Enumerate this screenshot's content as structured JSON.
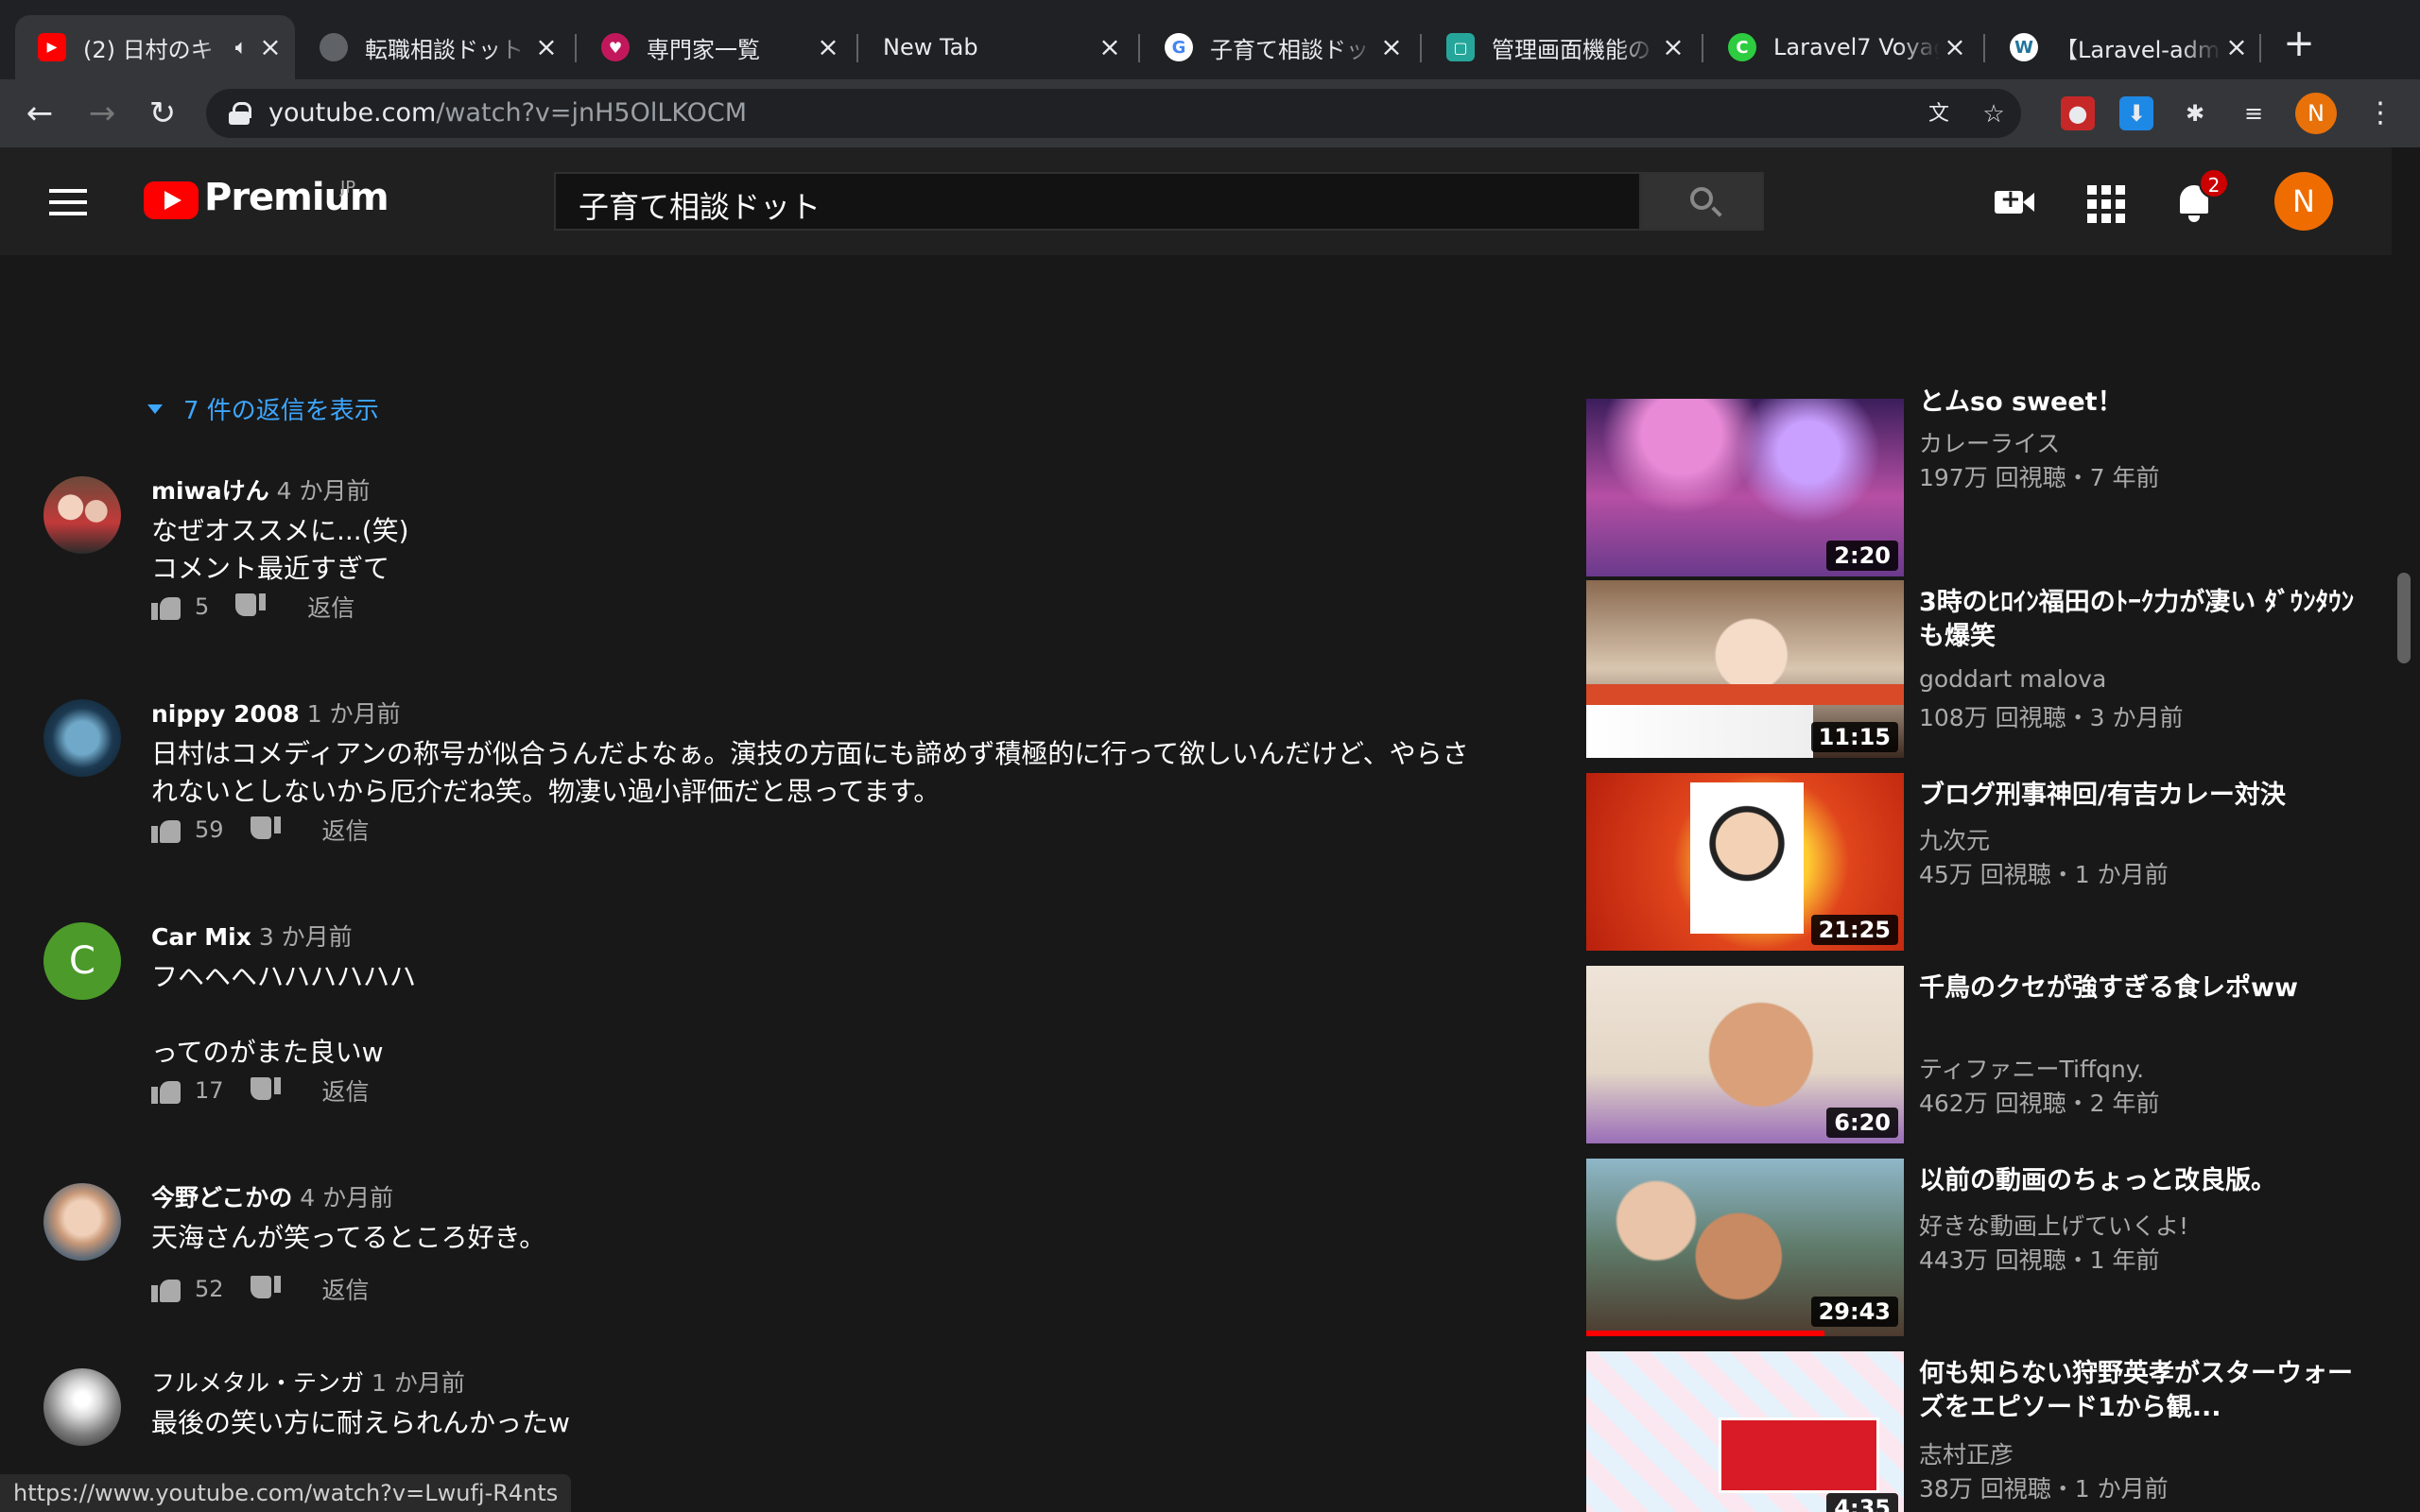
{
  "browser": {
    "tabs": [
      {
        "title": "(2) 日村のキ",
        "favicon": "youtube-icon",
        "favicon_color": "#ff0000",
        "active": true,
        "audio": true
      },
      {
        "title": "転職相談ドット",
        "favicon": "globe-icon",
        "favicon_color": "#5f6368"
      },
      {
        "title": "専門家一覧",
        "favicon": "heart-icon",
        "favicon_color": "#c2185b"
      },
      {
        "title": "New Tab",
        "favicon": "",
        "favicon_color": ""
      },
      {
        "title": "子育て相談ドッ",
        "favicon": "google-icon",
        "favicon_color": "#4285f4"
      },
      {
        "title": "管理画面機能の",
        "favicon": "doc-icon",
        "favicon_color": "#26a69a"
      },
      {
        "title": "Laravel7 Voyag",
        "favicon": "voyager-icon",
        "favicon_color": "#2ecc40"
      },
      {
        "title": "【Laravel-adm",
        "favicon": "wordpress-icon",
        "favicon_color": "#21759b"
      }
    ],
    "url_host": "youtube.com",
    "url_path": "/watch?v=jnH5OlLKOCM",
    "profile_initial": "N",
    "status_url": "https://www.youtube.com/watch?v=Lwufj-R4nts"
  },
  "masthead": {
    "brand": "Premium",
    "region": "JP",
    "search_query": "子育て相談ドット",
    "notification_count": "2",
    "avatar_initial": "N"
  },
  "comments": {
    "show_replies": "7 件の返信を表示",
    "reply_label": "返信",
    "items": [
      {
        "author": "miwaけん",
        "time": "4 か月前",
        "text": "なぜオススメに...(笑)\nコメント最近すぎて",
        "likes": "5"
      },
      {
        "author": "nippy 2008",
        "time": "1 か月前",
        "text": "日村はコメディアンの称号が似合うんだよなぁ。演技の方面にも諦めず積極的に行って欲しいんだけど、やらさ\nれないとしないから厄介だね笑。物凄い過小評価だと思ってます。",
        "likes": "59"
      },
      {
        "author": "Car Mix",
        "time": "3 か月前",
        "text": "フヘヘヘハハハハハハ\n\nってのがまた良いw",
        "likes": "17",
        "avatar_initial": "C"
      },
      {
        "author": "今野どこかの",
        "time": "4 か月前",
        "text": "天海さんが笑ってるところ好き。",
        "likes": "52"
      },
      {
        "author": "フルメタル・テンガ",
        "time": "1 か月前",
        "text": "最後の笑い方に耐えられんかったw",
        "likes": ""
      }
    ]
  },
  "related": [
    {
      "title": "とムso sweet！",
      "channel": "カレーライス",
      "meta": "197万 回視聴・7 年前",
      "duration": "2:20"
    },
    {
      "title": "3時のﾋﾛｲﾝ福田のﾄｰｸ力が凄い ﾀﾞｳﾝﾀｳﾝも爆笑",
      "channel": "goddart malova",
      "meta": "108万 回視聴・3 か月前",
      "duration": "11:15"
    },
    {
      "title": "ブログ刑事神回/有吉カレー対決",
      "channel": "九次元",
      "meta": "45万 回視聴・1 か月前",
      "duration": "21:25"
    },
    {
      "title": "千鳥のクセが強すぎる食レポww",
      "channel": "ティファニーTiffqny.",
      "meta": "462万 回視聴・2 年前",
      "duration": "6:20"
    },
    {
      "title": "以前の動画のちょっと改良版。",
      "channel": "好きな動画上げていくよ!",
      "meta": "443万 回視聴・1 年前",
      "duration": "29:43",
      "watched_fraction": 0.75
    },
    {
      "title": "何も知らない狩野英孝がスターウォーズをエピソード1から観...",
      "channel": "志村正彦",
      "meta": "38万 回視聴・1 か月前",
      "duration": "4:35"
    }
  ]
}
